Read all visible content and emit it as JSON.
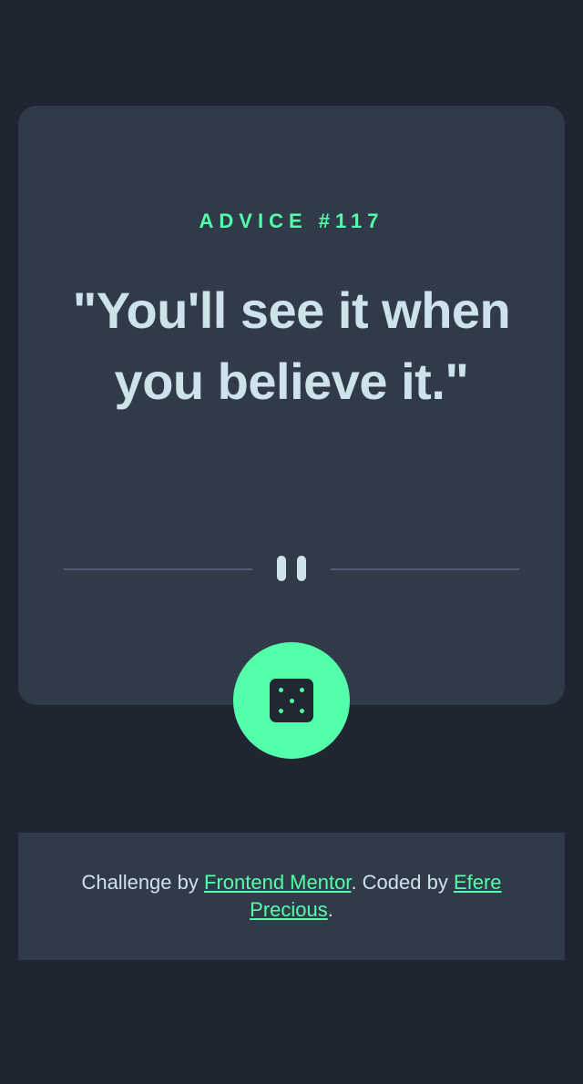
{
  "card": {
    "advice_label": "ADVICE #117",
    "quote": "\"You'll see it when you believe it.\""
  },
  "divider": {
    "icon": "pause-icon"
  },
  "generate_button": {
    "icon": "dice-icon"
  },
  "footer": {
    "prefix": "Challenge by ",
    "link1_text": "Frontend Mentor",
    "middle": ". Coded by ",
    "link2_text": "Efere Precious",
    "suffix": "."
  },
  "colors": {
    "background": "#1f2632",
    "card": "#313a48",
    "accent": "#53ffaa",
    "text": "#cee3e9",
    "divider": "#4f5d74"
  }
}
